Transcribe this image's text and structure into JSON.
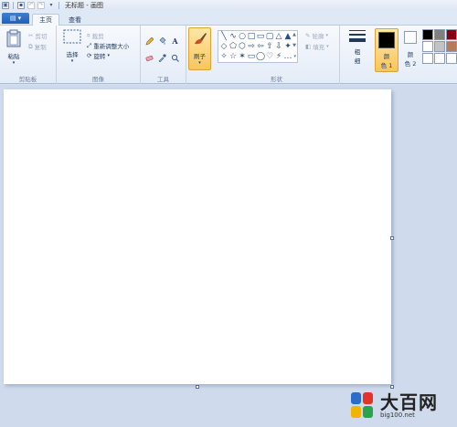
{
  "window": {
    "title": "无标题 - 画图"
  },
  "tabs": {
    "file_label": "▤ ▾",
    "home": "主页",
    "view": "查看"
  },
  "clipboard": {
    "paste": "粘贴",
    "cut": "剪切",
    "copy": "复制",
    "group": "剪贴板"
  },
  "image": {
    "select": "选择",
    "crop": "裁剪",
    "resize": "重新调整大小",
    "rotate": "旋转",
    "group": "图像"
  },
  "tools": {
    "group": "工具"
  },
  "brushes": {
    "label": "刷子"
  },
  "shapes": {
    "outline": "轮廓",
    "fill": "填充",
    "group": "形状",
    "glyphs": [
      "╲",
      "∿",
      "○",
      "□",
      "▭",
      "▢",
      "△",
      "▲",
      "◇",
      "⬠",
      "⬡",
      "⇨",
      "⇦",
      "⇧",
      "⇩",
      "✦",
      "✧",
      "☆",
      "✶",
      "▭",
      "◯",
      "♡",
      "⚡",
      "…"
    ]
  },
  "size": {
    "label1": "粗",
    "label2": "细"
  },
  "colors": {
    "color1_label1": "颜",
    "color1_label2": "色 1",
    "color2_label1": "颜",
    "color2_label2": "色 2",
    "color1_value": "#000000",
    "color2_value": "#ffffff",
    "palette": [
      "#000000",
      "#7f7f7f",
      "#880015",
      "#ffffff",
      "#c3c3c3",
      "#b97a57",
      "#ffffff",
      "#ffffff",
      "#ffffff"
    ]
  },
  "watermark": {
    "main": "大百网",
    "sub": "big100.net"
  }
}
